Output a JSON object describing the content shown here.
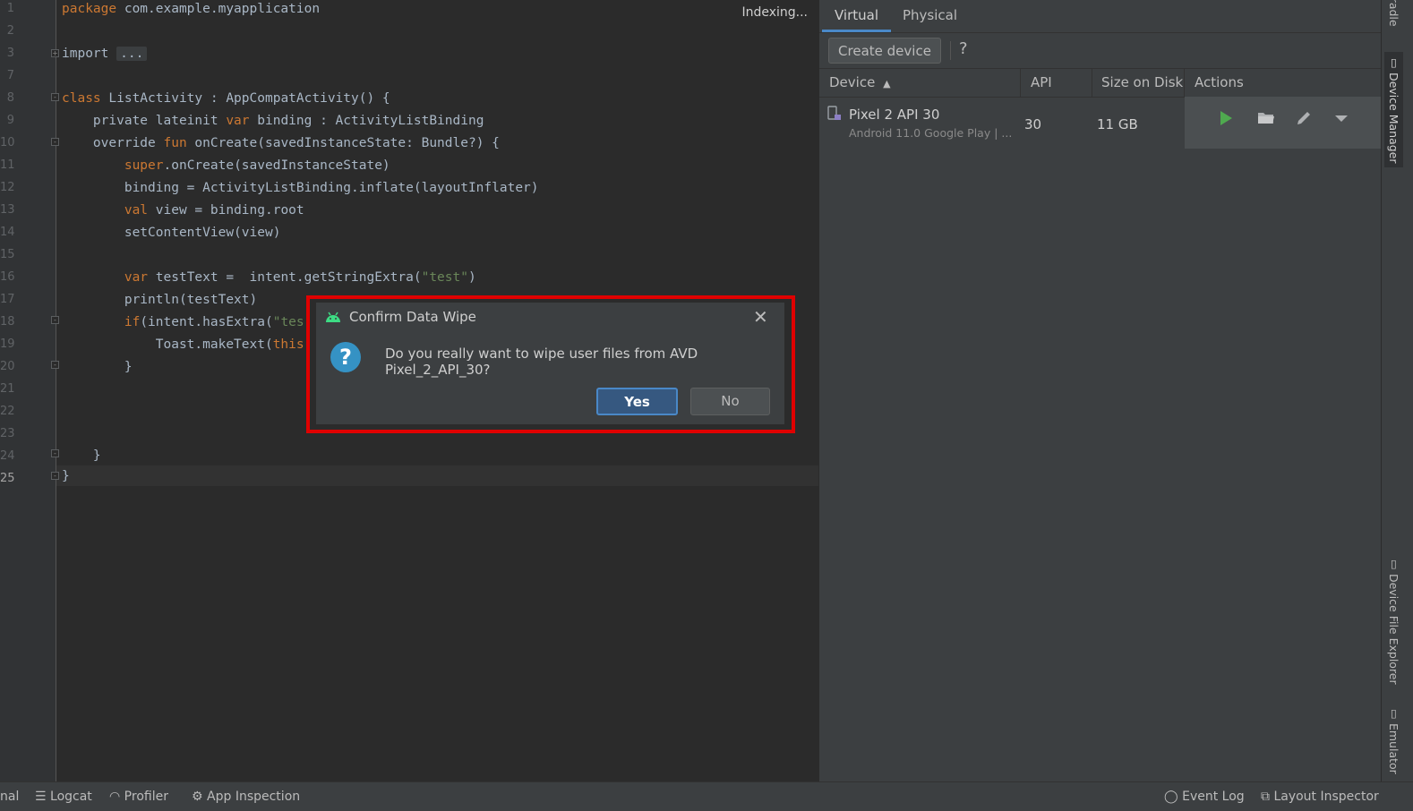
{
  "editor": {
    "status": "Indexing...",
    "line_numbers": [
      "1",
      "2",
      "3",
      "7",
      "8",
      "9",
      "10",
      "11",
      "12",
      "13",
      "14",
      "15",
      "16",
      "17",
      "18",
      "19",
      "20",
      "21",
      "22",
      "23",
      "24",
      "25"
    ],
    "lines": {
      "l1_kw": "package",
      "l1_rest": " com.example.myapplication",
      "l3_kw": "import",
      "l3_fold": "...",
      "l8_kw": "class",
      "l8_rest": " ListActivity : AppCompatActivity() {",
      "l9_a": "    private lateinit ",
      "l9_kw": "var",
      "l9_b": " binding : ActivityListBinding",
      "l10_a": "    override ",
      "l10_kw": "fun",
      "l10_b": " onCreate(savedInstanceState: Bundle?) {",
      "l11_a": "        ",
      "l11_kw": "super",
      "l11_b": ".onCreate(savedInstanceState)",
      "l12": "        binding = ActivityListBinding.inflate(layoutInflater)",
      "l13_a": "        ",
      "l13_kw": "val",
      "l13_b": " view = binding.root",
      "l14": "        setContentView(view)",
      "l16_a": "        ",
      "l16_kw": "var",
      "l16_b": " testText =  intent.getStringExtra(",
      "l16_str": "\"test\"",
      "l16_c": ")",
      "l17": "        println(testText)",
      "l18_a": "        ",
      "l18_kw": "if",
      "l18_b": "(intent.hasExtra(",
      "l18_str": "\"tes",
      "l19_a": "            Toast.makeText(",
      "l19_kw": "this",
      "l19_b": ",",
      "l20": "        }",
      "l24": "    }",
      "l25": "}"
    }
  },
  "device_manager": {
    "tabs": [
      "Virtual",
      "Physical"
    ],
    "create_button": "Create device",
    "help": "?",
    "columns": [
      "Device",
      "API",
      "Size on Disk",
      "Actions"
    ],
    "sort_indicator": "▲",
    "devices": [
      {
        "name": "Pixel 2 API 30",
        "subtitle": "Android 11.0 Google Play | ...",
        "api": "30",
        "size": "11 GB"
      }
    ]
  },
  "right_strip": {
    "items": [
      "Gradle",
      "Device Manager",
      "Device File Explorer",
      "Emulator"
    ]
  },
  "bottom_bar": {
    "left": [
      "nal",
      "Logcat",
      "Profiler",
      "App Inspection"
    ],
    "right": [
      "Event Log",
      "Layout Inspector"
    ]
  },
  "dialog": {
    "title": "Confirm Data Wipe",
    "message": "Do you really want to wipe user files from AVD Pixel_2_API_30?",
    "yes": "Yes",
    "no": "No"
  },
  "colors": {
    "highlight": "#e00000",
    "accent": "#4a88c7",
    "keyword": "#cc7832",
    "string": "#6a8759",
    "run_icon": "#4faa4f"
  }
}
